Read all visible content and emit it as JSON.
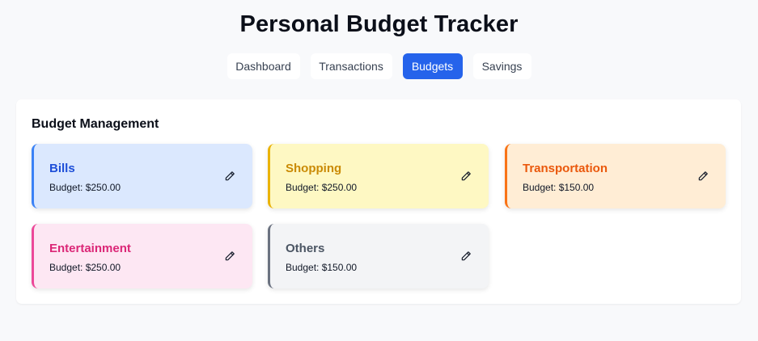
{
  "app": {
    "title": "Personal Budget Tracker"
  },
  "nav": {
    "tabs": [
      {
        "label": "Dashboard"
      },
      {
        "label": "Transactions"
      },
      {
        "label": "Budgets"
      },
      {
        "label": "Savings"
      }
    ],
    "active_tab": "Budgets",
    "active_color": "#2563eb"
  },
  "budgets": {
    "title": "Budget Management",
    "cards": [
      {
        "name": "Bills",
        "amount": "Budget: $250.00",
        "bg": "#dbe8fe",
        "accent": "#3b82f6",
        "text": "#1d4ed8",
        "icon": "pencil-icon"
      },
      {
        "name": "Shopping",
        "amount": "Budget: $250.00",
        "bg": "#fef8c3",
        "accent": "#eab308",
        "text": "#ca8a04",
        "icon": "pencil-icon"
      },
      {
        "name": "Transportation",
        "amount": "Budget: $150.00",
        "bg": "#ffedd5",
        "accent": "#f97316",
        "text": "#ea580c",
        "icon": "pencil-icon"
      },
      {
        "name": "Entertainment",
        "amount": "Budget: $250.00",
        "bg": "#fde7f3",
        "accent": "#ec4899",
        "text": "#db2777",
        "icon": "pencil-icon"
      },
      {
        "name": "Others",
        "amount": "Budget: $150.00",
        "bg": "#f3f4f6",
        "accent": "#6b7280",
        "text": "#4b5563",
        "icon": "pencil-icon"
      }
    ]
  }
}
